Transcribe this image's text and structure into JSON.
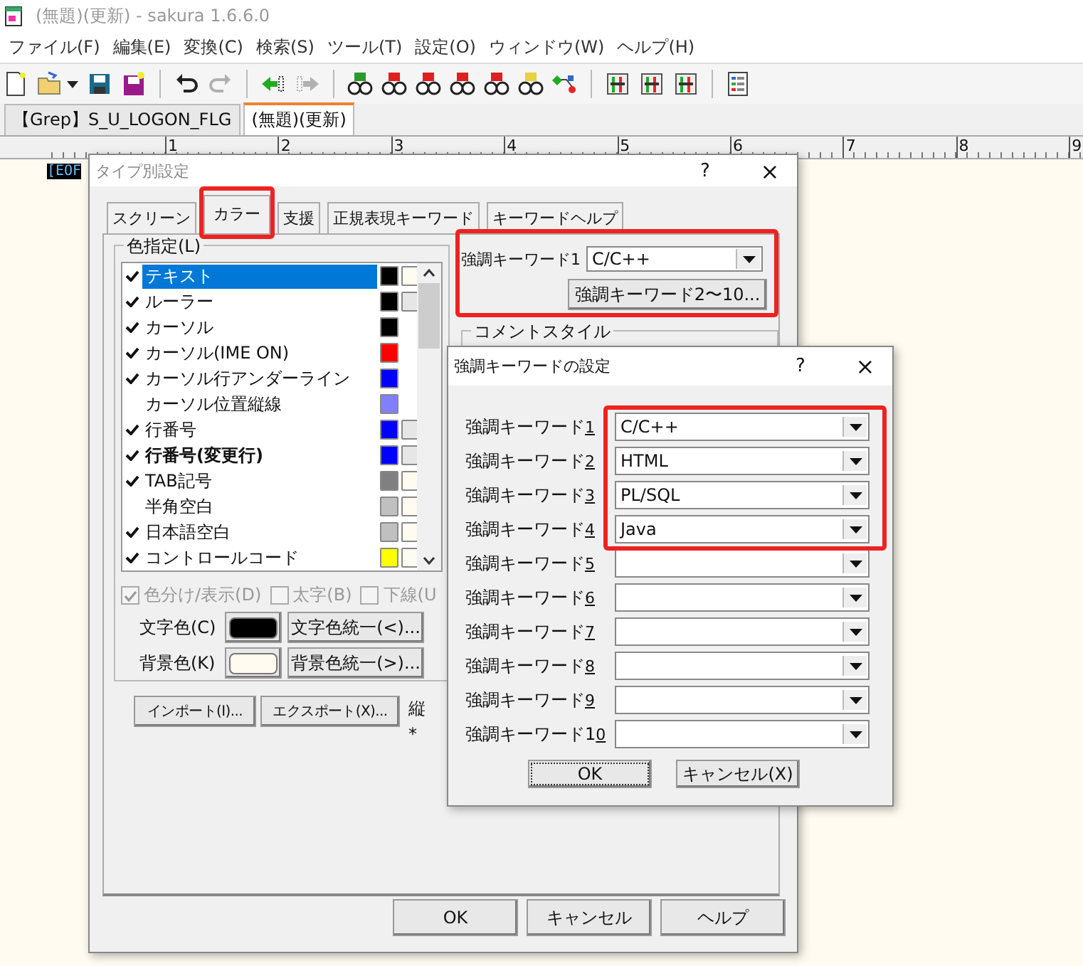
{
  "window": {
    "title": "(無題)(更新) - sakura 1.6.6.0"
  },
  "menu": [
    "ファイル(F)",
    "編集(E)",
    "変換(C)",
    "検索(S)",
    "ツール(T)",
    "設定(O)",
    "ウィンドウ(W)",
    "ヘルプ(H)"
  ],
  "toolbar": [
    [
      {
        "disabled": false
      },
      {
        "disabled": false
      },
      {
        "disabled": false
      },
      {
        "disabled": false
      },
      {
        "disabled": false
      }
    ],
    [
      {
        "disabled": false
      },
      {
        "disabled": true
      }
    ],
    [
      {
        "disabled": false
      },
      {
        "disabled": true
      }
    ],
    [
      {
        "disabled": false
      },
      {
        "disabled": false
      },
      {
        "disabled": false
      },
      {
        "disabled": false
      },
      {
        "disabled": false
      },
      {
        "disabled": false
      },
      {
        "disabled": false
      }
    ],
    [
      {
        "disabled": false
      },
      {
        "disabled": false
      },
      {
        "disabled": false
      }
    ],
    [
      {
        "disabled": false
      }
    ]
  ],
  "doc_tabs": [
    {
      "label": "【Grep】S_U_LOGON_FLG",
      "selected": false
    },
    {
      "label": "(無題)(更新)",
      "selected": true
    }
  ],
  "ruler": [
    "1",
    "2",
    "3",
    "4",
    "5",
    "6",
    "7",
    "8",
    "9"
  ],
  "editor": {
    "eof": "[EOF"
  },
  "type_dialog": {
    "title": "タイプ別設定",
    "help": "?",
    "close": "×",
    "tabs": [
      {
        "label": "スクリーン",
        "selected": false
      },
      {
        "label": "カラー",
        "selected": true
      },
      {
        "label": "支援",
        "selected": false
      },
      {
        "label": "正規表現キーワード",
        "selected": false
      },
      {
        "label": "キーワードヘルプ",
        "selected": false
      }
    ],
    "color_group": {
      "legend": "色指定(L)",
      "items": [
        {
          "label": "テキスト",
          "checked": true,
          "bold": false,
          "selected": true,
          "swatches": [
            {
              "color": "#000000"
            },
            {
              "color": "#fffbf0"
            }
          ]
        },
        {
          "label": "ルーラー",
          "checked": true,
          "bold": false,
          "selected": false,
          "swatches": [
            {
              "color": "#000000"
            },
            {
              "color": "#e6e6e6"
            }
          ]
        },
        {
          "label": "カーソル",
          "checked": true,
          "bold": false,
          "selected": false,
          "swatches": [
            {
              "color": "#000000"
            }
          ]
        },
        {
          "label": "カーソル(IME ON)",
          "checked": true,
          "bold": false,
          "selected": false,
          "swatches": [
            {
              "color": "#ff0000"
            }
          ]
        },
        {
          "label": "カーソル行アンダーライン",
          "checked": true,
          "bold": false,
          "selected": false,
          "swatches": [
            {
              "color": "#0000ff"
            }
          ]
        },
        {
          "label": "カーソル位置縦線",
          "checked": false,
          "bold": false,
          "selected": false,
          "swatches": [
            {
              "color": "#8080ff"
            }
          ]
        },
        {
          "label": "行番号",
          "checked": true,
          "bold": false,
          "selected": false,
          "swatches": [
            {
              "color": "#0000ff"
            },
            {
              "color": "#e6e6e6"
            }
          ]
        },
        {
          "label": "行番号(変更行)",
          "checked": true,
          "bold": true,
          "selected": false,
          "swatches": [
            {
              "color": "#0000ff"
            },
            {
              "color": "#e6e6e6"
            }
          ]
        },
        {
          "label": "TAB記号",
          "checked": true,
          "bold": false,
          "selected": false,
          "swatches": [
            {
              "color": "#808080"
            },
            {
              "color": "#fffbf0"
            }
          ]
        },
        {
          "label": "半角空白",
          "checked": false,
          "bold": false,
          "selected": false,
          "swatches": [
            {
              "color": "#c0c0c0"
            },
            {
              "color": "#fffbf0"
            }
          ]
        },
        {
          "label": "日本語空白",
          "checked": true,
          "bold": false,
          "selected": false,
          "swatches": [
            {
              "color": "#c0c0c0"
            },
            {
              "color": "#fffbf0"
            }
          ]
        },
        {
          "label": "コントロールコード",
          "checked": true,
          "bold": false,
          "selected": false,
          "swatches": [
            {
              "color": "#ffff00"
            },
            {
              "color": "#fffbf0"
            }
          ]
        }
      ],
      "checks": [
        {
          "label": "色分け/表示(D)",
          "checked": true,
          "disabled": true
        },
        {
          "label": "太字(B)",
          "checked": false,
          "disabled": true
        },
        {
          "label": "下線(U",
          "checked": false,
          "disabled": true
        }
      ],
      "text_color": {
        "label": "文字色(C)",
        "color": "#000000",
        "unify": "文字色統一(<)..."
      },
      "bg_color": {
        "label": "背景色(K)",
        "color": "#fffbf0",
        "unify": "背景色統一(>)..."
      }
    },
    "import": "インポート(I)...",
    "export": "エクスポート(X)...",
    "notes": [
      "縦",
      "*"
    ],
    "keyword1": {
      "label": "強調キーワード1",
      "value": "C/C++"
    },
    "more_button": "強調キーワード2〜10...",
    "comment_group": "コメントスタイル",
    "buttons": [
      "OK",
      "キャンセル",
      "ヘルプ"
    ]
  },
  "keyword_dialog": {
    "title": "強調キーワードの設定",
    "help": "?",
    "close": "×",
    "rows": [
      {
        "label": "強調キーワード",
        "accel": "1",
        "value": "C/C++"
      },
      {
        "label": "強調キーワード",
        "accel": "2",
        "value": "HTML"
      },
      {
        "label": "強調キーワード",
        "accel": "3",
        "value": "PL/SQL"
      },
      {
        "label": "強調キーワード",
        "accel": "4",
        "value": "Java"
      },
      {
        "label": "強調キーワード",
        "accel": "5"
      },
      {
        "label": "強調キーワード",
        "accel": "6"
      },
      {
        "label": "強調キーワード",
        "accel": "7"
      },
      {
        "label": "強調キーワード",
        "accel": "8"
      },
      {
        "label": "強調キーワード",
        "accel": "9"
      },
      {
        "label": "強調キーワード1",
        "accel": "0"
      }
    ],
    "ok": "OK",
    "cancel": "キャンセル(X)"
  }
}
